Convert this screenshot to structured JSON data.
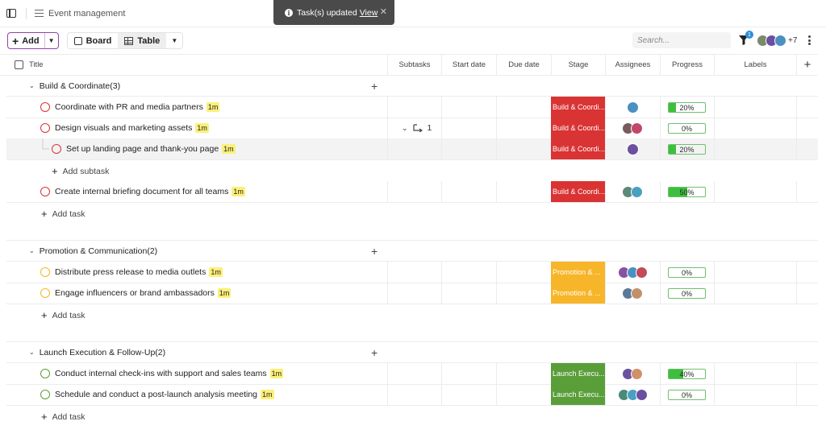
{
  "breadcrumb": {
    "project": "Event management"
  },
  "toast": {
    "message": "Task(s) updated",
    "link": "View"
  },
  "toolbar": {
    "add_label": "Add",
    "views": [
      {
        "label": "Board"
      },
      {
        "label": "Table"
      }
    ],
    "active_view": "Table",
    "search_placeholder": "Search...",
    "filter_count": "1",
    "members_more": "+7"
  },
  "columns": {
    "title": "Title",
    "subtasks": "Subtasks",
    "start_date": "Start date",
    "due_date": "Due date",
    "stage": "Stage",
    "assignees": "Assignees",
    "progress": "Progress",
    "labels": "Labels"
  },
  "colors": {
    "build": "#d93333",
    "promotion": "#f7b529",
    "launch": "#5a9e3a",
    "progress_fill": "#3dbf3d",
    "accent": "#8e44ad"
  },
  "groups": [
    {
      "name": "Build & Coordinate(3)",
      "tasks": [
        {
          "title": "Coordinate with PR and media partners",
          "tag": "1m",
          "stage": "Build & Coordi...",
          "progress": "20%",
          "progress_value": 0.2,
          "subtasks": ""
        },
        {
          "title": "Design visuals and marketing assets",
          "tag": "1m",
          "stage": "Build & Coordi...",
          "progress": "0%",
          "progress_value": 0,
          "subtasks": "1"
        },
        {
          "title": "Set up landing page and thank-you page",
          "tag": "1m",
          "stage": "Build & Coordi...",
          "progress": "20%",
          "progress_value": 0.2,
          "subtasks": ""
        },
        {
          "title": "Create internal briefing document for all teams",
          "tag": "1m",
          "stage": "Build & Coordi...",
          "progress": "50%",
          "progress_value": 0.5,
          "subtasks": ""
        }
      ],
      "add_subtask": "Add subtask",
      "add_task": "Add task"
    },
    {
      "name": "Promotion & Communication(2)",
      "tasks": [
        {
          "title": "Distribute press release to media outlets",
          "tag": "1m",
          "stage": "Promotion & ...",
          "progress": "0%",
          "progress_value": 0
        },
        {
          "title": "Engage influencers or brand ambassadors",
          "tag": "1m",
          "stage": "Promotion & ...",
          "progress": "0%",
          "progress_value": 0
        }
      ],
      "add_task": "Add task"
    },
    {
      "name": "Launch Execution & Follow-Up(2)",
      "tasks": [
        {
          "title": "Conduct internal check-ins with support and sales teams",
          "tag": "1m",
          "stage": "Launch Execu...",
          "progress": "40%",
          "progress_value": 0.4
        },
        {
          "title": "Schedule and conduct a post-launch analysis meeting",
          "tag": "1m",
          "stage": "Launch Execu...",
          "progress": "0%",
          "progress_value": 0
        }
      ],
      "add_task": "Add task"
    }
  ]
}
